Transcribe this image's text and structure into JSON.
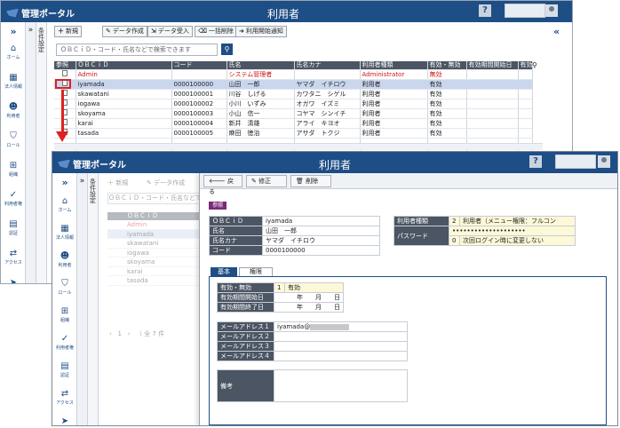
{
  "app": {
    "name": "管理ポータル",
    "title": "利用者",
    "help_label": "?"
  },
  "sidebar": {
    "items": [
      {
        "label": "ホーム",
        "icon": "home-icon",
        "glyph": "⌂"
      },
      {
        "label": "法人情報",
        "icon": "building-icon",
        "glyph": "▦"
      },
      {
        "label": "利用者",
        "icon": "users-icon",
        "glyph": "☻"
      },
      {
        "label": "ロール",
        "icon": "shield-icon",
        "glyph": "⛉"
      },
      {
        "label": "組織",
        "icon": "org-icon",
        "glyph": "⊞"
      },
      {
        "label": "利用者権",
        "icon": "shield-check-icon",
        "glyph": "✓"
      },
      {
        "label": "認証",
        "icon": "id-card-icon",
        "glyph": "▤"
      },
      {
        "label": "アクセス",
        "icon": "access-icon",
        "glyph": "⇄"
      },
      {
        "label": "通知",
        "icon": "send-icon",
        "glyph": "➤"
      }
    ]
  },
  "panel": {
    "collapse_glyph": "»",
    "filter_label": "条件設定",
    "close_glyph": "«"
  },
  "toolbar": {
    "new": "新規",
    "create": "データ作成",
    "import": "データ受入",
    "bulk_delete": "一括削除",
    "notify": "利用開始通知"
  },
  "search": {
    "placeholder": "ＯＢＣｉＤ・コード・氏名などで検索できます"
  },
  "list": {
    "headers": [
      "参照",
      "ＯＢＣｉＤ",
      "コード",
      "氏名",
      "氏名カナ",
      "利用者種類",
      "有効・無効",
      "有効期間開始日",
      "有効"
    ],
    "rows": [
      {
        "id": "Admin",
        "code": "",
        "name": "システム管理者",
        "kana": "",
        "type": "Administrator",
        "status": "無効",
        "red": true
      },
      {
        "id": "iyamada",
        "code": "0000100000",
        "name": "山田　一郎",
        "kana": "ヤマダ　イチロウ",
        "type": "利用者",
        "status": "有効",
        "selected": true
      },
      {
        "id": "skawatani",
        "code": "0000100001",
        "name": "川谷　しげる",
        "kana": "カワタニ　シゲル",
        "type": "利用者",
        "status": "有効"
      },
      {
        "id": "iogawa",
        "code": "0000100002",
        "name": "小川　いずみ",
        "kana": "オガワ　イズミ",
        "type": "利用者",
        "status": "有効"
      },
      {
        "id": "skoyama",
        "code": "0000100003",
        "name": "小山　信一",
        "kana": "コヤマ　シンイチ",
        "type": "利用者",
        "status": "有効"
      },
      {
        "id": "karai",
        "code": "0000100004",
        "name": "新井　清雄",
        "kana": "アライ　キヨオ",
        "type": "利用者",
        "status": "有効"
      },
      {
        "id": "tasada",
        "code": "0000100005",
        "name": "麻田　徳治",
        "kana": "アサダ　トクジ",
        "type": "利用者",
        "status": "有効"
      }
    ],
    "pager": "（ 全 7 件"
  },
  "detail": {
    "buttons": {
      "back": "戻る",
      "edit": "修正",
      "delete": "削除"
    },
    "badge": "参照",
    "fields": {
      "obcid_label": "ＯＢＣｉＤ",
      "obcid": "iyamada",
      "name_label": "氏名",
      "name": "山田　一郎",
      "kana_label": "氏名カナ",
      "kana": "ヤマダ　イチロウ",
      "code_label": "コード",
      "code": "0000100000",
      "type_label": "利用者種類",
      "type_num": "2",
      "type": "利用者（メニュー権限：フルコン",
      "pw_label": "パスワード",
      "pw": "••••••••••••••••••••",
      "pw_num": "0",
      "pw_note": "次回ログイン時に変更しない"
    },
    "tabs": {
      "basic": "基本",
      "perm": "権限"
    },
    "validity": {
      "status_label": "有効・無効",
      "status_num": "1",
      "status": "有効",
      "start_label": "有効期間開始日",
      "end_label": "有効期間終了日",
      "date": "年　　月　　日"
    },
    "mail": {
      "l1": "メールアドレス１",
      "v1": "iyamada@",
      "l2": "メールアドレス２",
      "l3": "メールアドレス３",
      "l4": "メールアドレス４"
    },
    "remarks_label": "備考"
  },
  "colors": {
    "header": "#1e4e86",
    "highlight_arrow": "#e02020",
    "selected_row": "#c9d6ee"
  }
}
